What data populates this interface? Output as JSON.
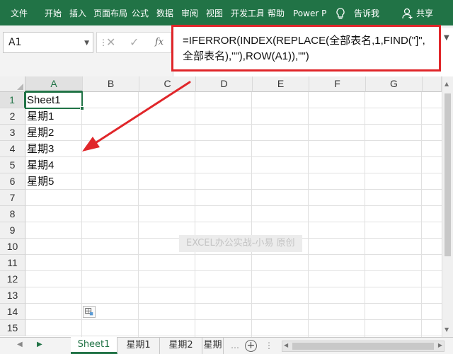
{
  "ribbon": {
    "tabs": [
      "文件",
      "开始",
      "插入",
      "页面布局",
      "公式",
      "数据",
      "审阅",
      "视图",
      "开发工具",
      "帮助",
      "Power P"
    ],
    "tell_me": "告诉我",
    "share": "共享",
    "bg_color": "#217346"
  },
  "formula_bar": {
    "name_box": "A1",
    "cancel_glyph": "✕",
    "enter_glyph": "✓",
    "fx": "fx",
    "formula": "=IFERROR(INDEX(REPLACE(全部表名,1,FIND(\"]\",全部表名),\"\"),ROW(A1)),\"\")",
    "highlight_color": "#e0262a"
  },
  "grid": {
    "columns": [
      "A",
      "B",
      "C",
      "D",
      "E",
      "F",
      "G"
    ],
    "rows": [
      "1",
      "2",
      "3",
      "4",
      "5",
      "6",
      "7",
      "8",
      "9",
      "10",
      "11",
      "12",
      "13",
      "14",
      "15"
    ],
    "column_a_values": [
      "Sheet1",
      "星期1",
      "星期2",
      "星期3",
      "星期4",
      "星期5"
    ],
    "selected_cell": "A1"
  },
  "watermark": "EXCEL办公实战-小易  原创",
  "sheet_tabs": {
    "tabs": [
      "Sheet1",
      "星期1",
      "星期2",
      "星期"
    ],
    "active": "Sheet1",
    "add_glyph": "+",
    "accent": "#217346"
  },
  "annotation_arrow_color": "#e0262a"
}
